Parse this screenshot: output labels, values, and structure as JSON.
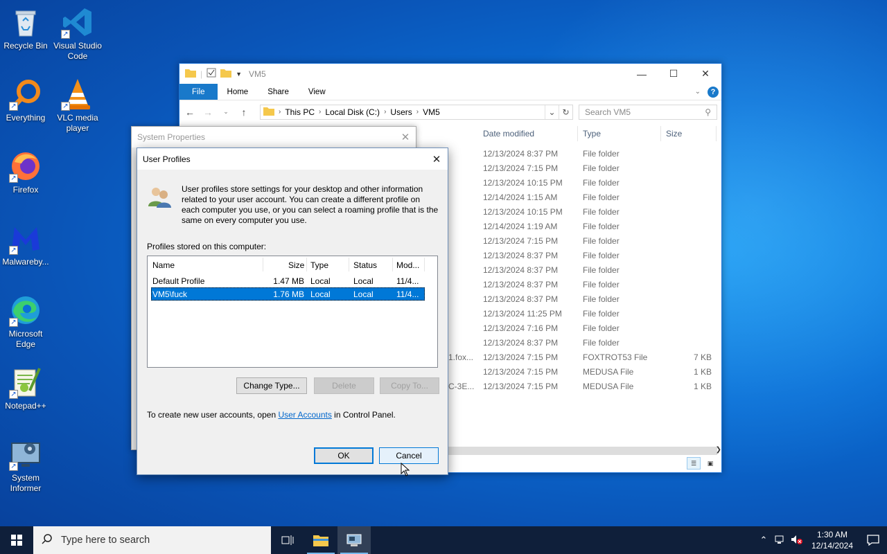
{
  "desktop": {
    "icons": [
      {
        "label": "Recycle Bin",
        "icon": "recycle-bin-icon"
      },
      {
        "label": "Visual Studio Code",
        "icon": "vscode-icon"
      },
      {
        "label": "Everything",
        "icon": "everything-search-icon"
      },
      {
        "label": "VLC media player",
        "icon": "vlc-icon"
      },
      {
        "label": "Firefox",
        "icon": "firefox-icon"
      },
      {
        "label": "Malwareby...",
        "icon": "malwarebytes-icon"
      },
      {
        "label": "Microsoft Edge",
        "icon": "edge-icon"
      },
      {
        "label": "Notepad++",
        "icon": "notepadpp-icon"
      },
      {
        "label": "System Informer",
        "icon": "system-informer-icon"
      }
    ]
  },
  "explorer": {
    "title": "VM5",
    "tabs": {
      "file": "File",
      "home": "Home",
      "share": "Share",
      "view": "View"
    },
    "breadcrumb": [
      "This PC",
      "Local Disk (C:)",
      "Users",
      "VM5"
    ],
    "search_placeholder": "Search VM5",
    "columns": {
      "date": "Date modified",
      "type": "Type",
      "size": "Size"
    },
    "rows": [
      {
        "name": "",
        "date": "12/13/2024 8:37 PM",
        "type": "File folder",
        "size": ""
      },
      {
        "name": "",
        "date": "12/13/2024 7:15 PM",
        "type": "File folder",
        "size": ""
      },
      {
        "name": "",
        "date": "12/13/2024 10:15 PM",
        "type": "File folder",
        "size": ""
      },
      {
        "name": "",
        "date": "12/14/2024 1:15 AM",
        "type": "File folder",
        "size": ""
      },
      {
        "name": "",
        "date": "12/13/2024 10:15 PM",
        "type": "File folder",
        "size": ""
      },
      {
        "name": "",
        "date": "12/14/2024 1:19 AM",
        "type": "File folder",
        "size": ""
      },
      {
        "name": "",
        "date": "12/13/2024 7:15 PM",
        "type": "File folder",
        "size": ""
      },
      {
        "name": "",
        "date": "12/13/2024 8:37 PM",
        "type": "File folder",
        "size": ""
      },
      {
        "name": "",
        "date": "12/13/2024 8:37 PM",
        "type": "File folder",
        "size": ""
      },
      {
        "name": "",
        "date": "12/13/2024 8:37 PM",
        "type": "File folder",
        "size": ""
      },
      {
        "name": "",
        "date": "12/13/2024 8:37 PM",
        "type": "File folder",
        "size": ""
      },
      {
        "name": "",
        "date": "12/13/2024 11:25 PM",
        "type": "File folder",
        "size": ""
      },
      {
        "name": "",
        "date": "12/13/2024 7:16 PM",
        "type": "File folder",
        "size": ""
      },
      {
        "name": "",
        "date": "12/13/2024 8:37 PM",
        "type": "File folder",
        "size": ""
      },
      {
        "name": "1.fox...",
        "date": "12/13/2024 7:15 PM",
        "type": "FOXTROT53 File",
        "size": "7 KB"
      },
      {
        "name": "",
        "date": "12/13/2024 7:15 PM",
        "type": "MEDUSA File",
        "size": "1 KB"
      },
      {
        "name": "C-3E...",
        "date": "12/13/2024 7:15 PM",
        "type": "MEDUSA File",
        "size": "1 KB"
      }
    ]
  },
  "system_properties": {
    "title": "System Properties"
  },
  "user_profiles": {
    "title": "User Profiles",
    "intro": "User profiles store settings for your desktop and other information related to your user account. You can create a different profile on each computer you use, or you can select a roaming profile that is the same on every computer you use.",
    "list_label": "Profiles stored on this computer:",
    "columns": {
      "name": "Name",
      "size": "Size",
      "type": "Type",
      "status": "Status",
      "modified": "Mod..."
    },
    "profiles": [
      {
        "name": "Default Profile",
        "size": "1.47 MB",
        "type": "Local",
        "status": "Local",
        "modified": "11/4...",
        "selected": false
      },
      {
        "name": "VM5\\fuck",
        "size": "1.76 MB",
        "type": "Local",
        "status": "Local",
        "modified": "11/4...",
        "selected": true
      }
    ],
    "buttons": {
      "change_type": "Change Type...",
      "delete": "Delete",
      "copy_to": "Copy To...",
      "ok": "OK",
      "cancel": "Cancel"
    },
    "footer_prefix": "To create new user accounts, open ",
    "footer_link": "User Accounts",
    "footer_suffix": " in Control Panel."
  },
  "taskbar": {
    "search_placeholder": "Type here to search",
    "time": "1:30 AM",
    "date": "12/14/2024"
  },
  "colors": {
    "accent": "#0078d7",
    "file_tab": "#1979ca",
    "taskbar": "#0f1f3a"
  }
}
